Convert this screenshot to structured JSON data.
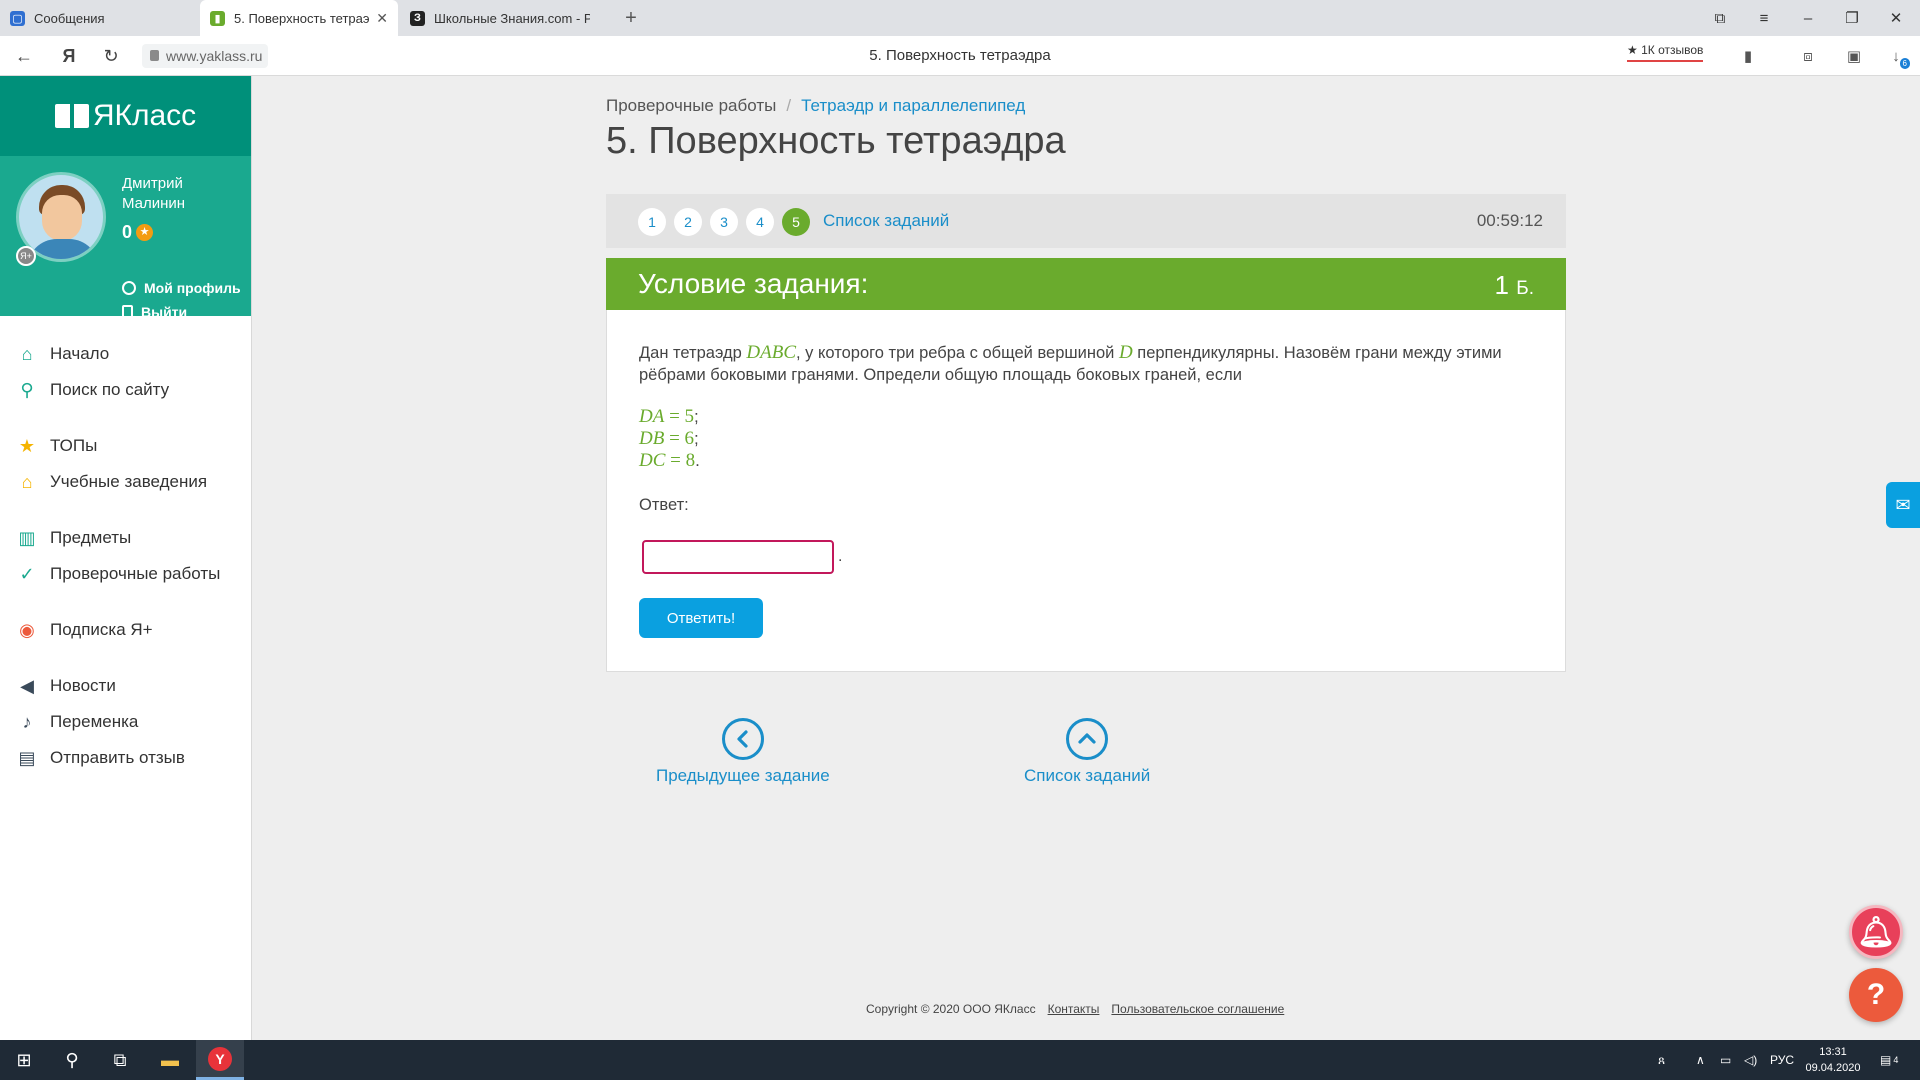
{
  "browser": {
    "tabs": [
      {
        "title": "Сообщения",
        "active": false
      },
      {
        "title": "5. Поверхность тетраэ…",
        "active": true
      },
      {
        "title": "Школьные Знания.com - Р",
        "active": false
      }
    ],
    "url": "www.yaklass.ru",
    "page_title": "5. Поверхность тетраэдра",
    "reviews": "★ 1К отзывов",
    "downloads_badge": "6"
  },
  "sidebar": {
    "logo": "ЯКласс",
    "user": {
      "name": "Дмитрий Малинин",
      "score": "0",
      "profile_link": "Мой профиль",
      "logout_link": "Выйти"
    },
    "menu": [
      {
        "label": "Начало",
        "icon": "home-icon"
      },
      {
        "label": "Поиск по сайту",
        "icon": "search-icon"
      },
      {
        "label": "ТОПы",
        "icon": "star-icon"
      },
      {
        "label": "Учебные заведения",
        "icon": "institution-icon"
      },
      {
        "label": "Предметы",
        "icon": "subjects-icon"
      },
      {
        "label": "Проверочные работы",
        "icon": "check-circle-icon"
      },
      {
        "label": "Подписка Я+",
        "icon": "subscription-icon"
      },
      {
        "label": "Новости",
        "icon": "megaphone-icon"
      },
      {
        "label": "Переменка",
        "icon": "bell-icon"
      },
      {
        "label": "Отправить отзыв",
        "icon": "feedback-icon"
      }
    ]
  },
  "main": {
    "breadcrumb": [
      "Проверочные работы",
      "Тетраэдр и параллелепипед"
    ],
    "title": "5. Поверхность тетраэдра",
    "steps": [
      "1",
      "2",
      "3",
      "4",
      "5"
    ],
    "active_step": "5",
    "task_list_link": "Список заданий",
    "timer": "00:59:12",
    "task_header": "Условие задания:",
    "points_value": "1",
    "points_unit": "Б.",
    "task_text": {
      "part1": "Дан тетраэдр ",
      "var1": "DABC",
      "part2": ", у которого три ребра с общей вершиной ",
      "var2": "D",
      "part3": " перпендикулярны. Назовём грани между этими рёбрами боковыми гранями. Определи общую площадь боковых граней, если"
    },
    "equations": [
      {
        "lhs": "DA",
        "rhs": "5",
        "end": ";"
      },
      {
        "lhs": "DB",
        "rhs": "6",
        "end": ";"
      },
      {
        "lhs": "DC",
        "rhs": "8",
        "end": "."
      }
    ],
    "answer_label": "Ответ:",
    "answer_value": "",
    "answer_suffix": ".",
    "submit_label": "Ответить!",
    "prev_task": "Предыдущее задание",
    "task_list": "Список заданий"
  },
  "footer": {
    "copyright": "Copyright © 2020 ООО ЯКласс",
    "contacts": "Контакты",
    "agreement": "Пользовательское соглашение"
  },
  "taskbar": {
    "lang": "РУС",
    "time": "13:31",
    "date": "09.04.2020",
    "notifications": "4"
  },
  "colors": {
    "brand_green": "#6aab2d",
    "sidebar_teal": "#00907a",
    "link_blue": "#1a8ec9",
    "button_blue": "#0aa0e0"
  }
}
